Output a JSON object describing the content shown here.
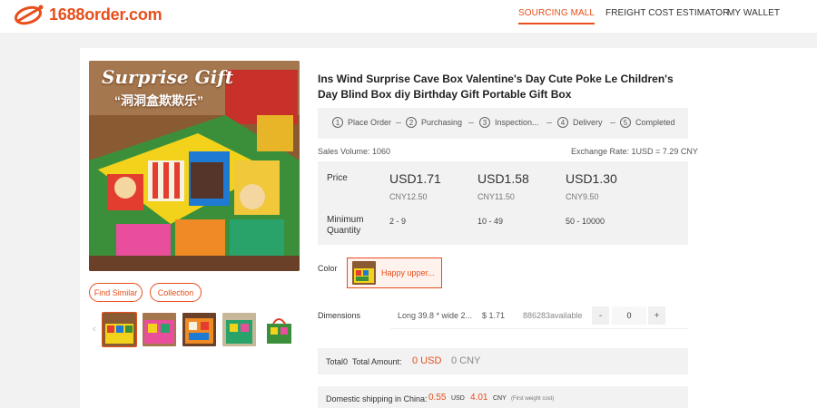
{
  "header": {
    "logo_text": "1688order.com",
    "nav": [
      "SOURCING MALL",
      "FREIGHT COST ESTIMATOR",
      "MY WALLET"
    ]
  },
  "product": {
    "image_overlay_title": "Surprise Gift",
    "image_overlay_subtitle": "“洞洞盒欺欺乐”",
    "title": "Ins Wind Surprise Cave Box Valentine's Day Cute Poke Le Children's Day Blind Box diy Birthday Gift Portable Gift Box",
    "find_similar": "Find Similar",
    "collection": "Collection",
    "thumb_prev": "‹"
  },
  "steps": [
    {
      "num": "1",
      "label": "Place Order"
    },
    {
      "num": "2",
      "label": "Purchasing"
    },
    {
      "num": "3",
      "label": "Inspection..."
    },
    {
      "num": "4",
      "label": "Delivery"
    },
    {
      "num": "5",
      "label": "Completed"
    }
  ],
  "meta": {
    "sales_volume": "Sales Volume:  1060",
    "exchange_rate": "Exchange Rate: 1USD = 7.29 CNY"
  },
  "pricing": {
    "price_label": "Price",
    "min_qty_label_1": "Minimum",
    "min_qty_label_2": "Quantity",
    "tiers": [
      {
        "usd": "USD1.71",
        "cny": "CNY12.50",
        "qty": "2 - 9"
      },
      {
        "usd": "USD1.58",
        "cny": "CNY11.50",
        "qty": "10 - 49"
      },
      {
        "usd": "USD1.30",
        "cny": "CNY9.50",
        "qty": "50 - 10000"
      }
    ]
  },
  "color": {
    "label": "Color",
    "option": "Happy upper..."
  },
  "dimensions": {
    "label": "Dimensions",
    "desc": "Long 39.8 * wide 2...",
    "price": "$ 1.71",
    "available": "886283available",
    "minus": "-",
    "plus": "+",
    "qty": "0"
  },
  "total": {
    "count": "Total0",
    "amount_label": "Total Amount:",
    "usd": "0 USD",
    "cny": "0 CNY"
  },
  "shipping": {
    "label": "Domestic shipping in China:",
    "usd_value": "0.55",
    "usd_unit": "USD",
    "cny_value": "4.01",
    "cny_unit": "CNY",
    "note": "(First weight cost)"
  },
  "colors": {
    "accent": "#e84e1b"
  }
}
